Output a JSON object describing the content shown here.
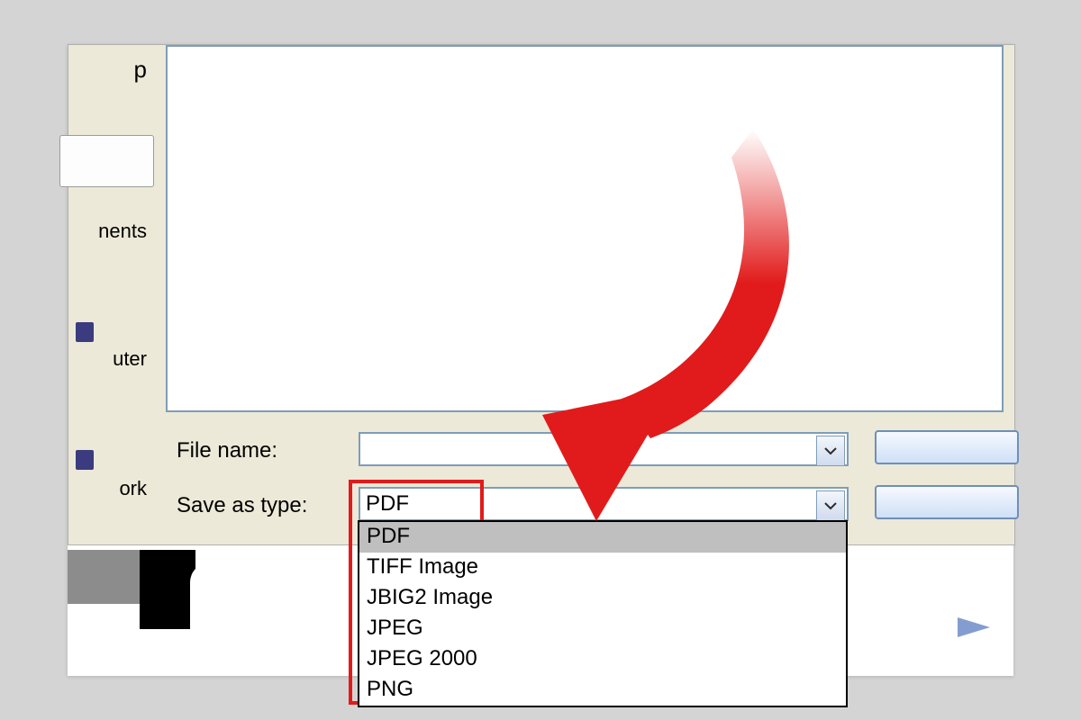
{
  "sidebar": {
    "items": [
      {
        "label_fragment": "p"
      },
      {
        "label_fragment": ""
      },
      {
        "label_fragment": "nents"
      },
      {
        "label_fragment": "uter"
      },
      {
        "label_fragment": "ork"
      }
    ]
  },
  "form": {
    "filename_label": "File name:",
    "filename_value": "",
    "saveastype_label": "Save as type:",
    "saveastype_value": "PDF"
  },
  "saveastype_options": [
    "PDF",
    "TIFF Image",
    "JBIG2 Image",
    "JPEG",
    "JPEG 2000",
    "PNG"
  ],
  "saveastype_selected_index": 0,
  "annotation": {
    "arrow_color": "#e11b1b"
  }
}
